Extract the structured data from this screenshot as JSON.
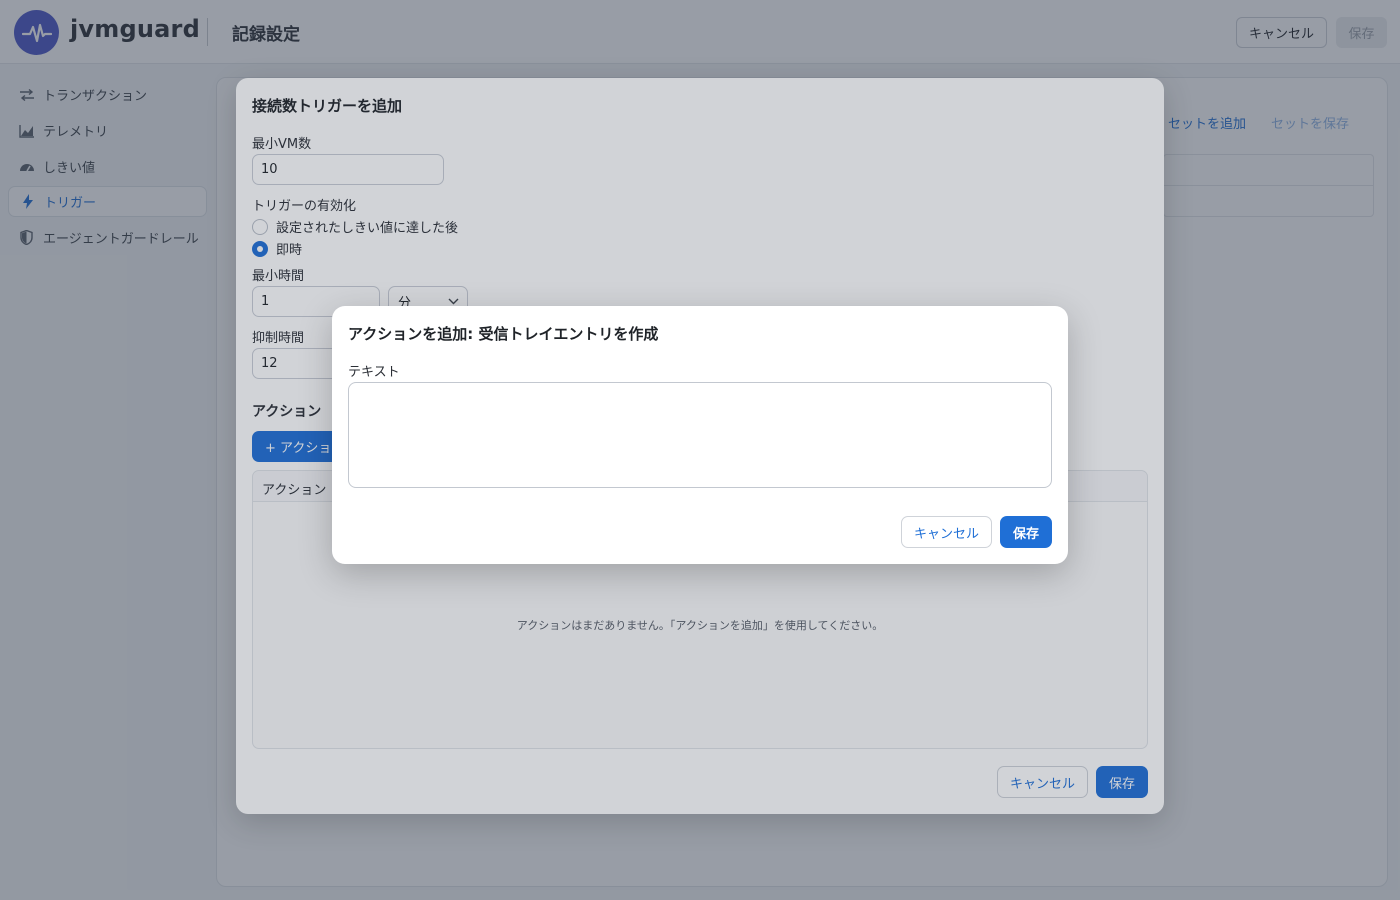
{
  "app": {
    "brand": "jvmguard",
    "page_title": "記録設定",
    "header_cancel": "キャンセル",
    "header_save": "保存"
  },
  "sidebar": {
    "items": [
      {
        "label": "トランザクション",
        "icon": "transactions-icon",
        "active": false
      },
      {
        "label": "テレメトリ",
        "icon": "chart-icon",
        "active": false
      },
      {
        "label": "しきい値",
        "icon": "gauge-icon",
        "active": false
      },
      {
        "label": "トリガー",
        "icon": "lightning-icon",
        "active": true
      },
      {
        "label": "エージェントガードレール",
        "icon": "shield-icon",
        "active": false
      }
    ]
  },
  "background": {
    "add_set_link": "セットを追加",
    "save_set_link": "セットを保存"
  },
  "trigger_dialog": {
    "title": "接続数トリガーを追加",
    "min_vm_label": "最小VM数",
    "min_vm_value": "10",
    "activation_label": "トリガーの有効化",
    "activation_options": [
      {
        "label": "設定されたしきい値に達した後",
        "checked": false
      },
      {
        "label": "即時",
        "checked": true
      }
    ],
    "min_time_label": "最小時間",
    "min_time_value": "1",
    "min_time_unit": "分",
    "suppress_label": "抑制時間",
    "suppress_value": "12",
    "actions_section": "アクション",
    "add_action_button": "+ アクション",
    "table_header": "アクション",
    "empty_message": "アクションはまだありません。「アクションを追加」を使用してください。",
    "cancel": "キャンセル",
    "save": "保存"
  },
  "action_dialog": {
    "title": "アクションを追加: 受信トレイエントリを作成",
    "text_label": "テキスト",
    "text_value": "",
    "cancel": "キャンセル",
    "save": "保存"
  },
  "colors": {
    "accent": "#1f6fd6",
    "logo": "#4b57c9"
  }
}
